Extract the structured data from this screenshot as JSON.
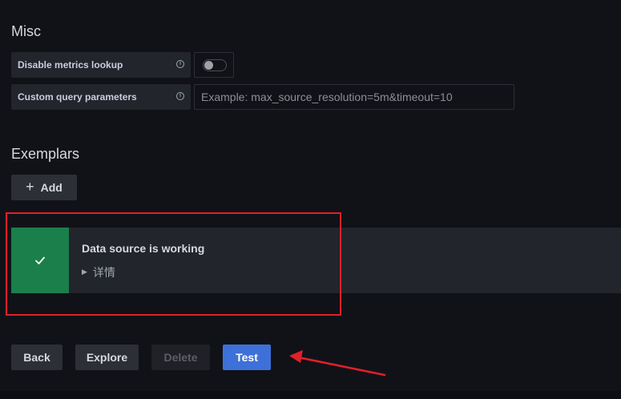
{
  "misc": {
    "title": "Misc",
    "disable_metrics_lookup": {
      "label": "Disable metrics lookup",
      "info_icon": "info-circle-icon",
      "enabled": false
    },
    "custom_query_parameters": {
      "label": "Custom query parameters",
      "info_icon": "info-circle-icon",
      "value": "",
      "placeholder": "Example: max_source_resolution=5m&timeout=10"
    }
  },
  "exemplars": {
    "title": "Exemplars",
    "add_label": "Add",
    "add_icon": "plus-icon"
  },
  "alert": {
    "icon": "check-icon",
    "status_color": "#1a7f4b",
    "title": "Data source is working",
    "details_label": "详情"
  },
  "actions": {
    "back": "Back",
    "explore": "Explore",
    "delete": "Delete",
    "test": "Test"
  },
  "colors": {
    "background": "#111217",
    "primary": "#3d71d9",
    "annotation": "#e0202a"
  }
}
